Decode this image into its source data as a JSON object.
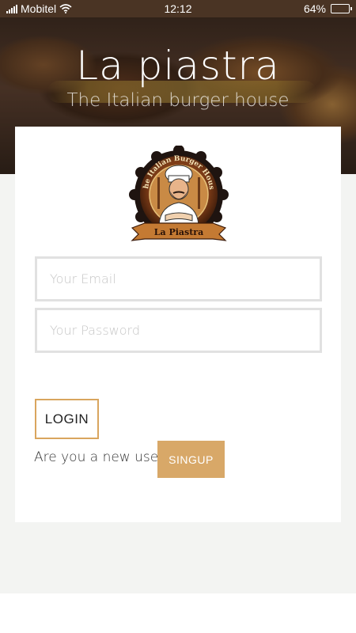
{
  "status_bar": {
    "carrier": "Mobitel",
    "time": "12:12",
    "battery_percent": "64%",
    "battery_level": 0.64,
    "icons": [
      "signal-icon",
      "wifi-icon",
      "battery-icon"
    ]
  },
  "hero": {
    "title": "La piastra",
    "subtitle": "The Italian burger house"
  },
  "logo": {
    "ring_text": "The Italian Burger House",
    "banner_text": "La Piastra"
  },
  "form": {
    "email_placeholder": "Your Email",
    "email_value": "",
    "password_placeholder": "Your Password",
    "password_value": "",
    "login_label": "LOGIN",
    "new_user_text": "Are you a new user?",
    "signup_label": "SINGUP"
  },
  "colors": {
    "accent": "#d9a55e",
    "signup_bg": "#d8a868",
    "page_bg": "#f3f4f2",
    "status_bar_bg": "#4a3424"
  }
}
